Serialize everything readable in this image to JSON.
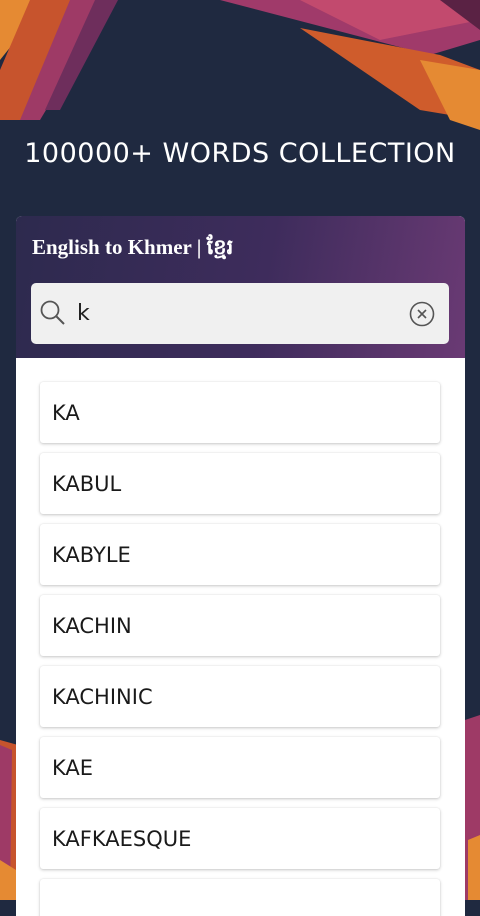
{
  "headline": "100000+ WORDS COLLECTION",
  "dictionary": {
    "title": "English to Khmer | ខ្មែរ"
  },
  "search": {
    "value": "k",
    "placeholder": ""
  },
  "words": [
    "KA",
    "KABUL",
    "KABYLE",
    "KACHIN",
    "KACHINIC",
    "KAE",
    "KAFKAESQUE",
    ""
  ],
  "colors": {
    "background": "#1f2940",
    "header_gradient_start": "#2d2a4e",
    "header_gradient_end": "#6a3a74",
    "accent_orange": "#d9692f",
    "accent_magenta": "#a23a6b"
  },
  "icons": {
    "search": "search-icon",
    "clear": "clear-circle-x-icon"
  }
}
